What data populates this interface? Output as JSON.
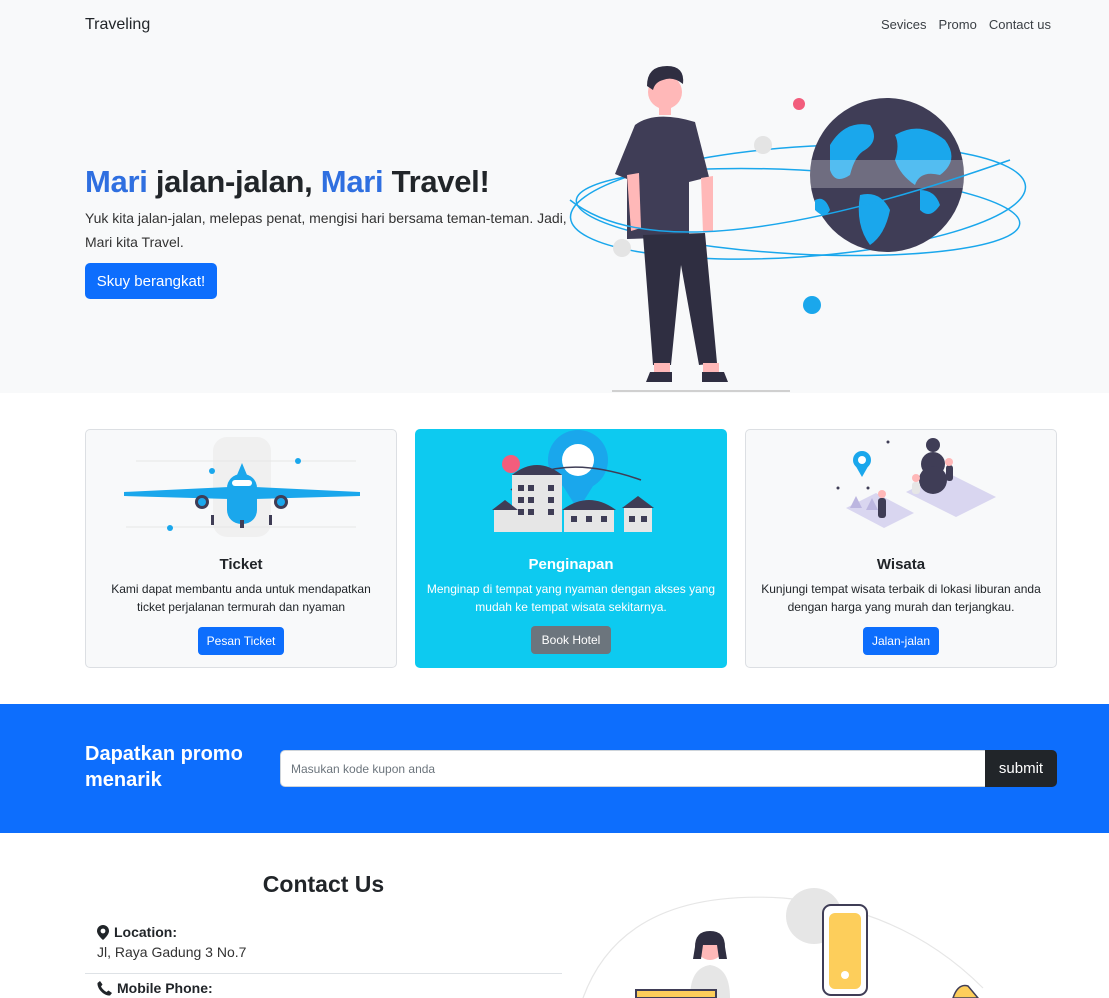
{
  "navbar": {
    "brand": "Traveling",
    "links": [
      "Sevices",
      "Promo",
      "Contact us"
    ]
  },
  "hero": {
    "title_part1": "Mari",
    "title_part2": " jalan-jalan, ",
    "title_part3": "Mari",
    "title_part4": " Travel!",
    "text": "Yuk kita jalan-jalan, melepas penat, mengisi hari bersama teman-teman. Jadi, Mari kita Travel.",
    "button": "Skuy berangkat!"
  },
  "cards": [
    {
      "title": "Ticket",
      "text": "Kami dapat membantu anda untuk mendapatkan ticket perjalanan termurah dan nyaman",
      "button": "Pesan Ticket"
    },
    {
      "title": "Penginapan",
      "text": "Menginap di tempat yang nyaman dengan akses yang mudah ke tempat wisata sekitarnya.",
      "button": "Book Hotel"
    },
    {
      "title": "Wisata",
      "text": "Kunjungi tempat wisata terbaik di lokasi liburan anda dengan harga yang murah dan terjangkau.",
      "button": "Jalan-jalan"
    }
  ],
  "promo": {
    "title": "Dapatkan promo menarik",
    "placeholder": "Masukan kode kupon anda",
    "button": "submit"
  },
  "contact": {
    "title": "Contact Us",
    "location_label": "Location:",
    "location_value": "Jl, Raya Gadung 3 No.7",
    "phone_label": "Mobile Phone:"
  },
  "colors": {
    "primary": "#0d6efd",
    "info": "#0dcaf0",
    "secondary": "#6c757d",
    "dark": "#212529",
    "light": "#f8f9fa"
  },
  "icons": [
    "map-marker-icon",
    "phone-icon"
  ]
}
